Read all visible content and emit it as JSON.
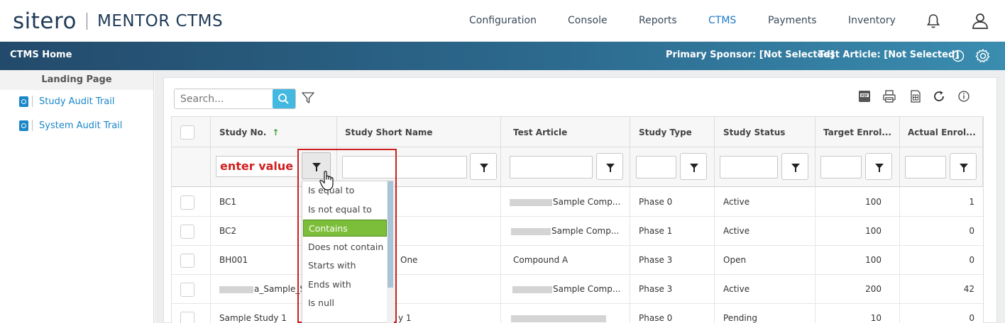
{
  "brand": {
    "logo": "sitero",
    "product": "MENTOR CTMS"
  },
  "nav": {
    "items": [
      "Configuration",
      "Console",
      "Reports",
      "CTMS",
      "Payments",
      "Inventory"
    ],
    "active": "CTMS"
  },
  "header_bar": {
    "title": "CTMS Home",
    "primary_sponsor": "Primary Sponsor: [Not Selected]",
    "test_article": "Test Article: [Not Selected]"
  },
  "sidebar": {
    "heading": "Landing Page",
    "items": [
      {
        "label": "Study Audit Trail",
        "icon": "audit-search-icon"
      },
      {
        "label": "System Audit Trail",
        "icon": "audit-search-icon"
      }
    ]
  },
  "toolbar": {
    "search_placeholder": "Search...",
    "icons": [
      "pdf-export-icon",
      "print-icon",
      "excel-export-icon",
      "refresh-icon",
      "info-icon"
    ]
  },
  "grid": {
    "columns": [
      "Study No.",
      "Study Short Name",
      "Test Article",
      "Study Type",
      "Study Status",
      "Target Enrol...",
      "Actual Enrol..."
    ],
    "sorted_column": "Study No.",
    "sort_direction": "ascending",
    "study_no_filter_value": "enter value",
    "rows": [
      {
        "study_no": "BC1",
        "short_name": "",
        "test_article": "Sample Comp...",
        "type": "Phase 0",
        "status": "Active",
        "target": "100",
        "actual": "1"
      },
      {
        "study_no": "BC2",
        "short_name": "",
        "test_article": "Sample Comp...",
        "type": "Phase 1",
        "status": "Active",
        "target": "100",
        "actual": "0"
      },
      {
        "study_no": "BH001",
        "short_name": "One",
        "test_article": "Compound A",
        "type": "Phase 3",
        "status": "Open",
        "target": "100",
        "actual": "0"
      },
      {
        "study_no": "a_Sample_St",
        "short_name": "",
        "test_article": "Sample Comp...",
        "type": "Phase 3",
        "status": "Active",
        "target": "200",
        "actual": "42"
      },
      {
        "study_no": "Sample Study 1",
        "short_name": "y 1",
        "test_article": "",
        "type": "Phase 0",
        "status": "Pending",
        "target": "10",
        "actual": "0"
      }
    ]
  },
  "filter_menu": {
    "options": [
      "Is equal to",
      "Is not equal to",
      "Contains",
      "Does not contain",
      "Starts with",
      "Ends with",
      "Is null"
    ],
    "selected": "Contains"
  },
  "colors": {
    "brand_navy": "#1f3b57",
    "active_nav": "#1f78c8",
    "link_blue": "#1a87c9",
    "selected_option": "#7cbd3a",
    "highlight_red": "#cc1f1f",
    "search_button": "#43b8e0"
  }
}
